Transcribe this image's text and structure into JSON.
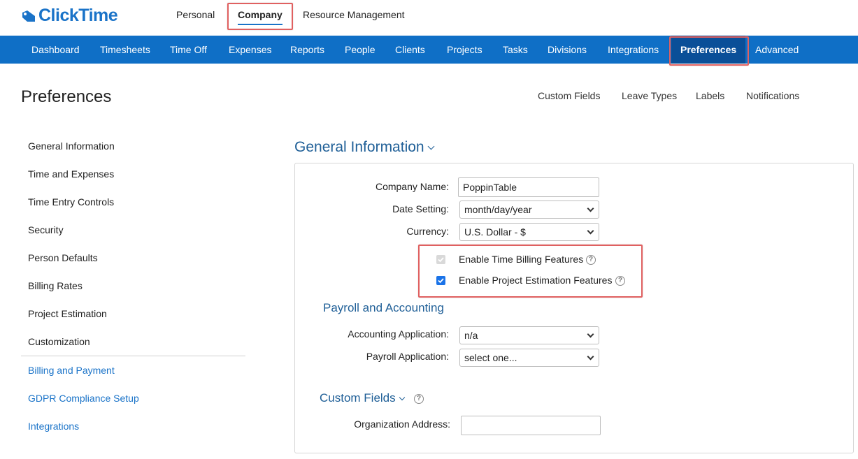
{
  "brand": {
    "name": "ClickTime",
    "color": "#1a73c8"
  },
  "top_nav": {
    "personal": "Personal",
    "company": "Company",
    "resource_management": "Resource Management"
  },
  "main_nav": {
    "dashboard": "Dashboard",
    "timesheets": "Timesheets",
    "time_off": "Time Off",
    "expenses": "Expenses",
    "reports": "Reports",
    "people": "People",
    "clients": "Clients",
    "projects": "Projects",
    "tasks": "Tasks",
    "divisions": "Divisions",
    "integrations": "Integrations",
    "preferences": "Preferences",
    "advanced": "Advanced"
  },
  "page": {
    "title": "Preferences",
    "subnav": {
      "custom_fields": "Custom Fields",
      "leave_types": "Leave Types",
      "labels": "Labels",
      "notifications": "Notifications"
    }
  },
  "sidebar": {
    "items": [
      "General Information",
      "Time and Expenses",
      "Time Entry Controls",
      "Security",
      "Person Defaults",
      "Billing Rates",
      "Project Estimation",
      "Customization"
    ],
    "links": [
      "Billing and Payment",
      "GDPR Compliance Setup",
      "Integrations"
    ]
  },
  "general": {
    "title": "General Information",
    "company_name_label": "Company Name:",
    "company_name_value": "PoppinTable",
    "date_setting_label": "Date Setting:",
    "date_setting_value": "month/day/year",
    "currency_label": "Currency:",
    "currency_value": "U.S. Dollar - $",
    "time_billing_label": "Enable Time Billing Features",
    "project_estimation_label": "Enable Project Estimation Features"
  },
  "payroll": {
    "title": "Payroll and Accounting",
    "accounting_label": "Accounting Application:",
    "accounting_value": "n/a",
    "payroll_label": "Payroll Application:",
    "payroll_value": "select one..."
  },
  "custom_fields": {
    "title": "Custom Fields",
    "org_address_label": "Organization Address:",
    "org_address_value": ""
  },
  "colors": {
    "nav_blue": "#0f6fc6",
    "nav_active": "#0a4f98",
    "highlight": "#e06060",
    "link": "#1a73c8"
  }
}
